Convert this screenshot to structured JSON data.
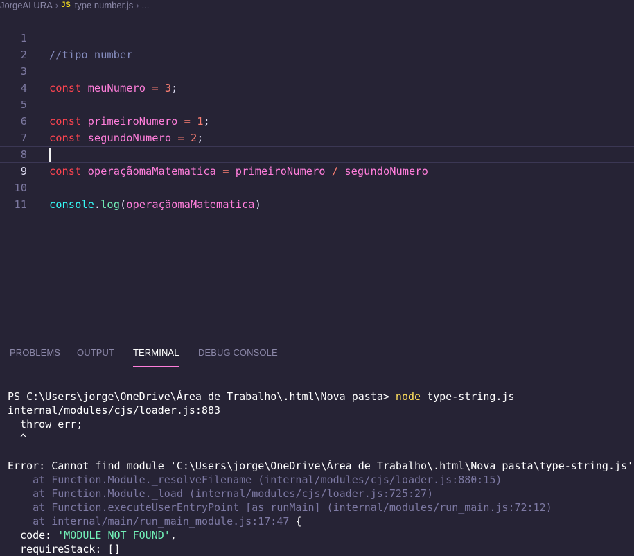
{
  "breadcrumb": {
    "folder": "JorgeALURA",
    "file_icon": "JS",
    "file": "type number.js",
    "ellipsis": "..."
  },
  "editor": {
    "line_numbers": [
      "1",
      "2",
      "3",
      "4",
      "5",
      "6",
      "7",
      "8",
      "9",
      "10",
      "11"
    ],
    "lines": {
      "l1": "//tipo number",
      "l3_kw": "const",
      "l3_var": "meuNumero",
      "l3_op": "=",
      "l3_num": "3",
      "l3_end": ";",
      "l5_kw": "const",
      "l5_var": "primeiroNumero",
      "l5_op": "=",
      "l5_num": "1",
      "l5_end": ";",
      "l6_kw": "const",
      "l6_var": "segundoNumero",
      "l6_op": "=",
      "l6_num": "2",
      "l6_end": ";",
      "l8_kw": "const",
      "l8_var": "operaçãomaMatematica",
      "l8_op": "=",
      "l8_a": "primeiroNumero",
      "l8_div": "/",
      "l8_b": "segundoNumero",
      "l10_obj": "console",
      "l10_dot": ".",
      "l10_fn": "log",
      "l10_open": "(",
      "l10_arg": "operaçãomaMatematica",
      "l10_close": ")"
    },
    "current_line": 9
  },
  "panel": {
    "tabs": [
      "PROBLEMS",
      "OUTPUT",
      "TERMINAL",
      "DEBUG CONSOLE"
    ],
    "active_tab": "TERMINAL"
  },
  "terminal": {
    "prompt": "PS C:\\Users\\jorge\\OneDrive\\Área de Trabalho\\.html\\Nova pasta>",
    "cmd": "node",
    "cmd_arg": "type-string.js",
    "l2": "internal/modules/cjs/loader.js:883",
    "l3": "  throw err;",
    "l4": "  ^",
    "l6": "Error: Cannot find module 'C:\\Users\\jorge\\OneDrive\\Área de Trabalho\\.html\\Nova pasta\\type-string.js'",
    "s1_at": "    at ",
    "s1": "Function.Module._resolveFilename (internal/modules/cjs/loader.js:880:15)",
    "s2_at": "    at ",
    "s2": "Function.Module._load (internal/modules/cjs/loader.js:725:27)",
    "s3_at": "    at ",
    "s3": "Function.executeUserEntryPoint [as runMain] (internal/modules/run_main.js:72:12)",
    "s4_at": "    at ",
    "s4": "internal/main/run_main_module.js:17:47",
    "s4_brace": " {",
    "code_key": "  code: ",
    "code_val": "'MODULE_NOT_FOUND'",
    "code_end": ",",
    "req": "  requireStack: []"
  }
}
